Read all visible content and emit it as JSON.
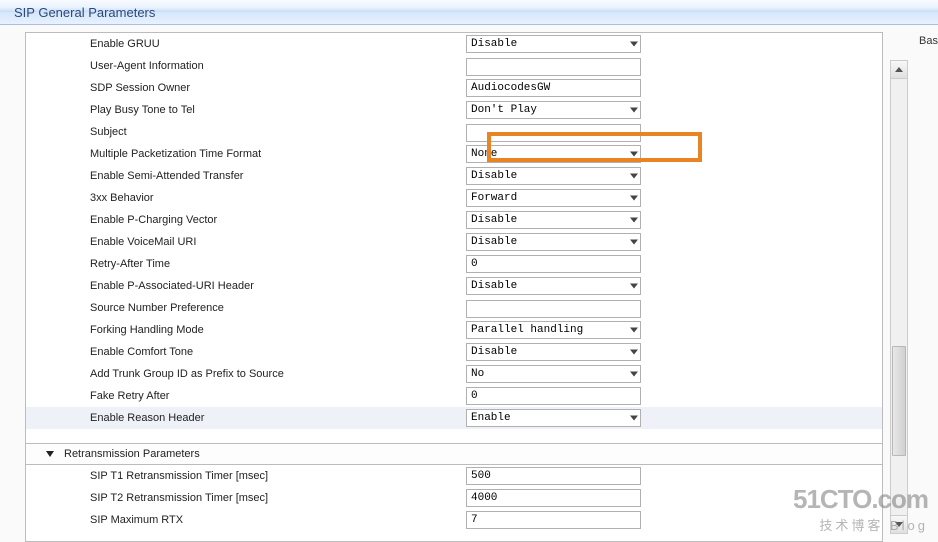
{
  "header": {
    "title": "SIP General Parameters"
  },
  "top_right": "Bas",
  "params": [
    {
      "label": "Enable GRUU",
      "type": "select",
      "value": "Disable"
    },
    {
      "label": "User-Agent Information",
      "type": "text",
      "value": ""
    },
    {
      "label": "SDP Session Owner",
      "type": "text",
      "value": "AudiocodesGW"
    },
    {
      "label": "Play Busy Tone to Tel",
      "type": "select",
      "value": "Don't Play"
    },
    {
      "label": "Subject",
      "type": "text",
      "value": ""
    },
    {
      "label": "Multiple Packetization Time Format",
      "type": "select",
      "value": "None",
      "highlight_box": true
    },
    {
      "label": "Enable Semi-Attended Transfer",
      "type": "select",
      "value": "Disable"
    },
    {
      "label": "3xx Behavior",
      "type": "select",
      "value": "Forward"
    },
    {
      "label": "Enable P-Charging Vector",
      "type": "select",
      "value": "Disable"
    },
    {
      "label": "Enable VoiceMail URI",
      "type": "select",
      "value": "Disable"
    },
    {
      "label": "Retry-After Time",
      "type": "text",
      "value": "0"
    },
    {
      "label": "Enable P-Associated-URI Header",
      "type": "select",
      "value": "Disable"
    },
    {
      "label": "Source Number Preference",
      "type": "text",
      "value": ""
    },
    {
      "label": "Forking Handling Mode",
      "type": "select",
      "value": "Parallel handling"
    },
    {
      "label": "Enable Comfort Tone",
      "type": "select",
      "value": "Disable"
    },
    {
      "label": "Add Trunk Group ID as Prefix to Source",
      "type": "select",
      "value": "No"
    },
    {
      "label": "Fake Retry After",
      "type": "text",
      "value": "0"
    },
    {
      "label": "Enable Reason Header",
      "type": "select",
      "value": "Enable",
      "row_highlight": true
    }
  ],
  "section": {
    "title": "Retransmission Parameters"
  },
  "retrans": [
    {
      "label": "SIP T1 Retransmission Timer [msec]",
      "value": "500"
    },
    {
      "label": "SIP T2 Retransmission Timer [msec]",
      "value": "4000"
    },
    {
      "label": "SIP Maximum RTX",
      "value": "7"
    }
  ],
  "watermark": {
    "big": "51CTO.com",
    "small": "技术博客  Blog"
  }
}
